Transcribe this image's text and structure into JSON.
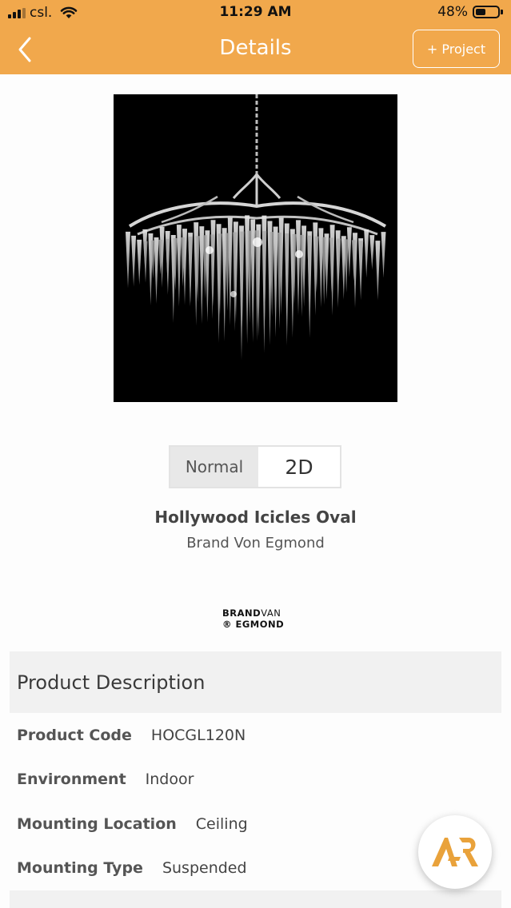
{
  "status_bar": {
    "carrier": "csl.",
    "time": "11:29 AM",
    "battery_percent": "48%",
    "battery_level": 0.48,
    "signal_icon": "signal-bars-icon",
    "wifi_icon": "wifi-icon"
  },
  "nav": {
    "title": "Details",
    "back_icon": "chevron-left-icon",
    "project_button": "+ Project"
  },
  "product": {
    "image_icon": "chandelier-image",
    "view_toggle": {
      "normal": "Normal",
      "two_d": "2D",
      "selected": "Normal"
    },
    "name": "Hollywood Icicles Oval",
    "brand": "Brand Von Egmond",
    "logo": {
      "brand_bold": "BRAND",
      "brand_light": "VAN",
      "line2": "® EGMOND"
    }
  },
  "description": {
    "header": "Product Description",
    "rows": [
      {
        "key": "Product Code",
        "value": "HOCGL120N"
      },
      {
        "key": "Environment",
        "value": "Indoor"
      },
      {
        "key": "Mounting Location",
        "value": "Ceiling"
      },
      {
        "key": "Mounting Type",
        "value": "Suspended"
      }
    ]
  },
  "ar_button": {
    "label": "AR",
    "icon": "ar-icon"
  },
  "colors": {
    "header_orange": "#f1a84c",
    "ar_orange": "#e9a23b",
    "panel_grey": "#f1f1f1"
  }
}
